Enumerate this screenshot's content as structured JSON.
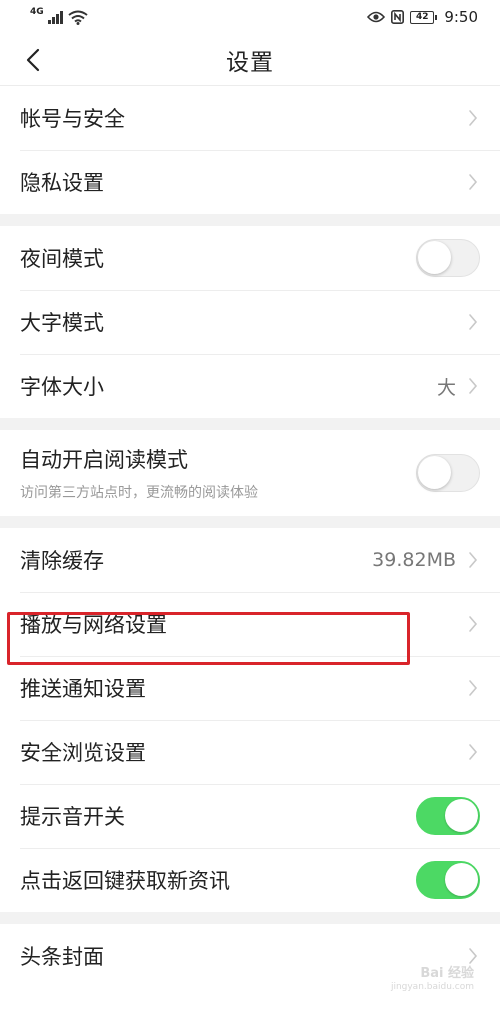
{
  "status_bar": {
    "signal_label": "4G",
    "battery_level": "42",
    "time": "9:50"
  },
  "header": {
    "title": "设置"
  },
  "settings": [
    {
      "label": "帐号与安全",
      "control": "chevron"
    },
    {
      "label": "隐私设置",
      "control": "chevron"
    },
    {
      "label": "夜间模式",
      "control": "toggle",
      "on": false
    },
    {
      "label": "大字模式",
      "control": "chevron"
    },
    {
      "label": "字体大小",
      "control": "chevron",
      "value": "大"
    },
    {
      "label": "自动开启阅读模式",
      "sublabel": "访问第三方站点时，更流畅的阅读体验",
      "control": "toggle",
      "on": false
    },
    {
      "label": "清除缓存",
      "control": "chevron",
      "value": "39.82MB"
    },
    {
      "label": "播放与网络设置",
      "control": "chevron",
      "highlighted": true
    },
    {
      "label": "推送通知设置",
      "control": "chevron"
    },
    {
      "label": "安全浏览设置",
      "control": "chevron"
    },
    {
      "label": "提示音开关",
      "control": "toggle",
      "on": true
    },
    {
      "label": "点击返回键获取新资讯",
      "control": "toggle",
      "on": true
    },
    {
      "label": "头条封面",
      "control": "chevron"
    }
  ],
  "watermark": {
    "text": "Bai 经验",
    "sub": "jingyan.baidu.com"
  },
  "colors": {
    "toggle_on": "#4cd964",
    "highlight": "#d9242a",
    "section_gap": "#f2f2f2"
  }
}
